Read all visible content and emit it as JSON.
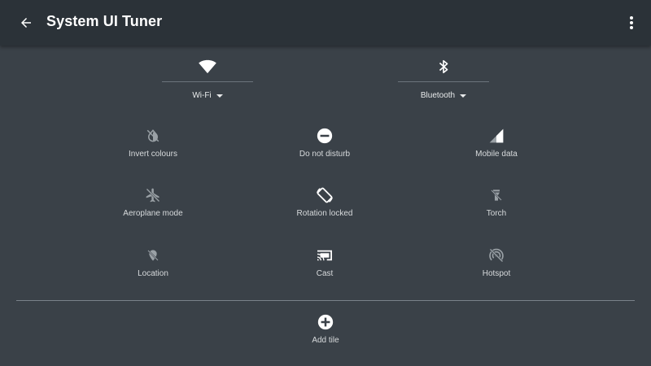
{
  "appbar": {
    "title": "System UI Tuner",
    "back_icon": "arrow-back-icon",
    "overflow_icon": "more-vert-icon"
  },
  "big_tiles": [
    {
      "label": "Wi-Fi",
      "icon": "wifi-icon"
    },
    {
      "label": "Bluetooth",
      "icon": "bluetooth-icon"
    }
  ],
  "tiles": [
    {
      "label": "Invert colours",
      "icon": "invert-colours-off-icon"
    },
    {
      "label": "Do not disturb",
      "icon": "do-not-disturb-icon"
    },
    {
      "label": "Mobile data",
      "icon": "mobile-data-icon"
    },
    {
      "label": "Aeroplane mode",
      "icon": "airplane-mode-off-icon"
    },
    {
      "label": "Rotation locked",
      "icon": "screen-rotation-icon"
    },
    {
      "label": "Torch",
      "icon": "flashlight-off-icon"
    },
    {
      "label": "Location",
      "icon": "location-off-icon"
    },
    {
      "label": "Cast",
      "icon": "cast-icon"
    },
    {
      "label": "Hotspot",
      "icon": "hotspot-off-icon"
    }
  ],
  "add_tile": {
    "label": "Add tile",
    "icon": "add-circle-icon"
  },
  "colors": {
    "background": "#3a4148",
    "appbar": "#2b3238",
    "icon_active": "#ffffff",
    "icon_inactive": "#9aa1a6"
  }
}
